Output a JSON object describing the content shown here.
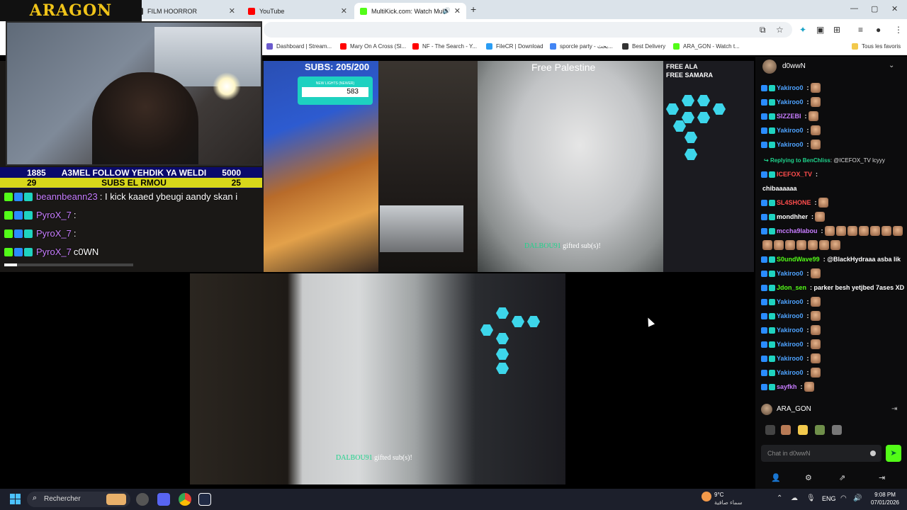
{
  "browser": {
    "tabs": [
      {
        "title": "FILM HOORROR",
        "color": "#3b3b3b"
      },
      {
        "title": "YouTube",
        "color": "#ff0000"
      },
      {
        "title": "MultiKick.com: Watch Multi",
        "color": "#53fc18"
      }
    ],
    "new_tab": "+",
    "window_controls": [
      "—",
      "▢",
      "✕"
    ],
    "bookmarks": [
      {
        "label": "Dashboard | Stream...",
        "color": "#6a5acd"
      },
      {
        "label": "Mary On A Cross (Sl...",
        "color": "#ff0000"
      },
      {
        "label": "NF - The Search - Y...",
        "color": "#ff0000"
      },
      {
        "label": "FileCR | Download",
        "color": "#2a9df4"
      },
      {
        "label": "sporcle party - بحث...",
        "color": "#ffffff"
      },
      {
        "label": "Best Delivery",
        "color": "#333333"
      },
      {
        "label": "ARA_GON - Watch t...",
        "color": "#53fc18"
      }
    ],
    "all_bookmarks": "Tous les favoris"
  },
  "overlay": {
    "brand": "ARAGON",
    "goal": {
      "left_value": "1885",
      "text": "A3MEL FOLLOW YEHDIK YA WELDI",
      "right_value": "5000"
    },
    "subs": {
      "left_value": "29",
      "text": "SUBS EL RMOU",
      "right_value": "25"
    },
    "chat": [
      {
        "user": "beannbeann23",
        "text": ": I kick kaaed ybeugi aandy skan i"
      },
      {
        "user": "PyroX_7",
        "text": ":"
      },
      {
        "user": "PyroX_7",
        "text": ":"
      },
      {
        "user": "PyroX_7",
        "text": "c0WN"
      }
    ]
  },
  "streams": {
    "subs_title": "SUBS: 205/200",
    "lights_label": "NEW LIGHTS (NEWER)",
    "lights_value": "583",
    "free_palestine": "Free Palestine",
    "free_ala": "FREE ALA",
    "free_samara": "FREE SAMARA",
    "gifted_user": "DALBOU91",
    "gifted_text": "gifted",
    "gifted_subs": "sub(s)!"
  },
  "chat_panel": {
    "channel": "d0wwN",
    "messages": [
      {
        "user": "Yakiroo0",
        "color": "#4ea3ff",
        "text": ":",
        "emote": true
      },
      {
        "user": "Yakiroo0",
        "color": "#4ea3ff",
        "text": ":",
        "emote": true
      },
      {
        "user": "SIZZEBI",
        "color": "#c77dff",
        "text": ":",
        "emote": true
      },
      {
        "user": "Yakiroo0",
        "color": "#4ea3ff",
        "text": ":",
        "emote": true
      },
      {
        "user": "Yakiroo0",
        "color": "#4ea3ff",
        "text": ":",
        "emote": true
      }
    ],
    "reply_prefix": "Replying to",
    "reply_user": "BenChliss",
    "reply_text": ": @ICEFOX_TV lcyyy",
    "messages2": [
      {
        "user": "ICEFOX_TV",
        "color": "#ff4d4d",
        "text": ":",
        "emote": false
      },
      {
        "user": "",
        "color": "#ffffff",
        "text": "chibaaaaaa",
        "emote": false
      },
      {
        "user": "SL4SHONE",
        "color": "#ff4d4d",
        "text": ":",
        "emote": true
      },
      {
        "user": "mondhher",
        "color": "#ffffff",
        "text": ":",
        "emote": true
      },
      {
        "user": "mccha9labou",
        "color": "#c77dff",
        "text": ":",
        "emote": true
      },
      {
        "user": "",
        "color": "#ffffff",
        "text": "",
        "emote": true
      },
      {
        "user": "S0undWave99",
        "color": "#53fc18",
        "text": ": @BlackHydraaa asba lik",
        "emote": false
      },
      {
        "user": "Yakiroo0",
        "color": "#4ea3ff",
        "text": ":",
        "emote": true
      },
      {
        "user": "Jdon_sen",
        "color": "#53fc18",
        "text": ": parker besh yetjbed 7ases XD",
        "emote": false
      },
      {
        "user": "Yakiroo0",
        "color": "#4ea3ff",
        "text": ":",
        "emote": true
      },
      {
        "user": "Yakiroo0",
        "color": "#4ea3ff",
        "text": ":",
        "emote": true
      },
      {
        "user": "Yakiroo0",
        "color": "#4ea3ff",
        "text": ":",
        "emote": true
      },
      {
        "user": "Yakiroo0",
        "color": "#4ea3ff",
        "text": ":",
        "emote": true
      },
      {
        "user": "Yakiroo0",
        "color": "#4ea3ff",
        "text": ":",
        "emote": true
      },
      {
        "user": "Yakiroo0",
        "color": "#4ea3ff",
        "text": ":",
        "emote": true
      },
      {
        "user": "sayfkh",
        "color": "#c77dff",
        "text": ":",
        "emote": true
      }
    ],
    "current_user": "ARA_GON",
    "input_placeholder": "Chat in d0wwN"
  },
  "taskbar": {
    "search_label": "Rechercher",
    "weather_temp": "9°C",
    "weather_desc": "سماء صافية",
    "language": "ENG",
    "time": "9:08 PM",
    "date": "07/01/2026"
  }
}
